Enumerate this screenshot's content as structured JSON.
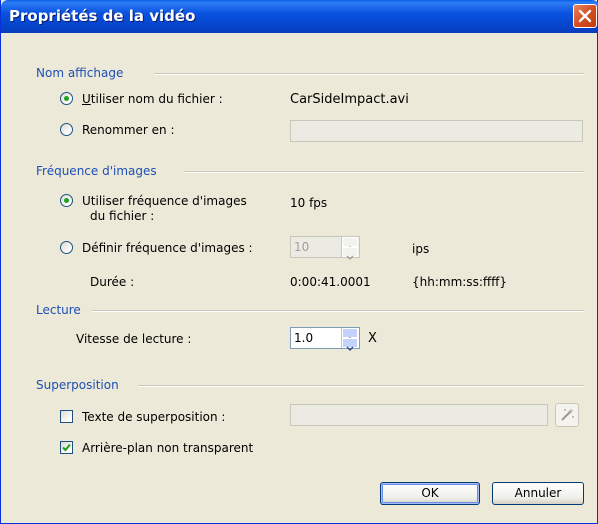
{
  "window": {
    "title": "Propriétés de la vidéo"
  },
  "nom_affichage": {
    "group_label": "Nom affichage",
    "use_filename_label": "Utiliser nom du fichier :",
    "filename": "CarSideImpact.avi",
    "rename_label": "Renommer en :",
    "rename_value": ""
  },
  "frequence": {
    "group_label": "Fréquence d'images",
    "use_file_fps_line1": "Utiliser fréquence d'images",
    "use_file_fps_line2": "du fichier :",
    "file_fps": "10 fps",
    "define_fps_label": "Définir fréquence d'images :",
    "define_fps_value": "10",
    "define_fps_unit": "ips",
    "duration_label": "Durée :",
    "duration_value": "0:00:41.0001",
    "duration_format": "{hh:mm:ss:ffff}"
  },
  "lecture": {
    "group_label": "Lecture",
    "speed_label": "Vitesse de lecture :",
    "speed_value": "1.0",
    "speed_unit": "X"
  },
  "superposition": {
    "group_label": "Superposition",
    "overlay_text_label": "Texte de superposition :",
    "overlay_text_value": "",
    "opaque_bg_label": "Arrière-plan non transparent"
  },
  "buttons": {
    "ok": "OK",
    "cancel": "Annuler"
  },
  "state": {
    "use_filename_checked": true,
    "use_file_fps_checked": true,
    "overlay_text_checked": false,
    "opaque_bg_checked": true
  },
  "colors": {
    "titlebar": "#0a52e0",
    "group_label": "#1e4fb5",
    "radio_dot": "#21a121",
    "close_button": "#d34b1e"
  }
}
